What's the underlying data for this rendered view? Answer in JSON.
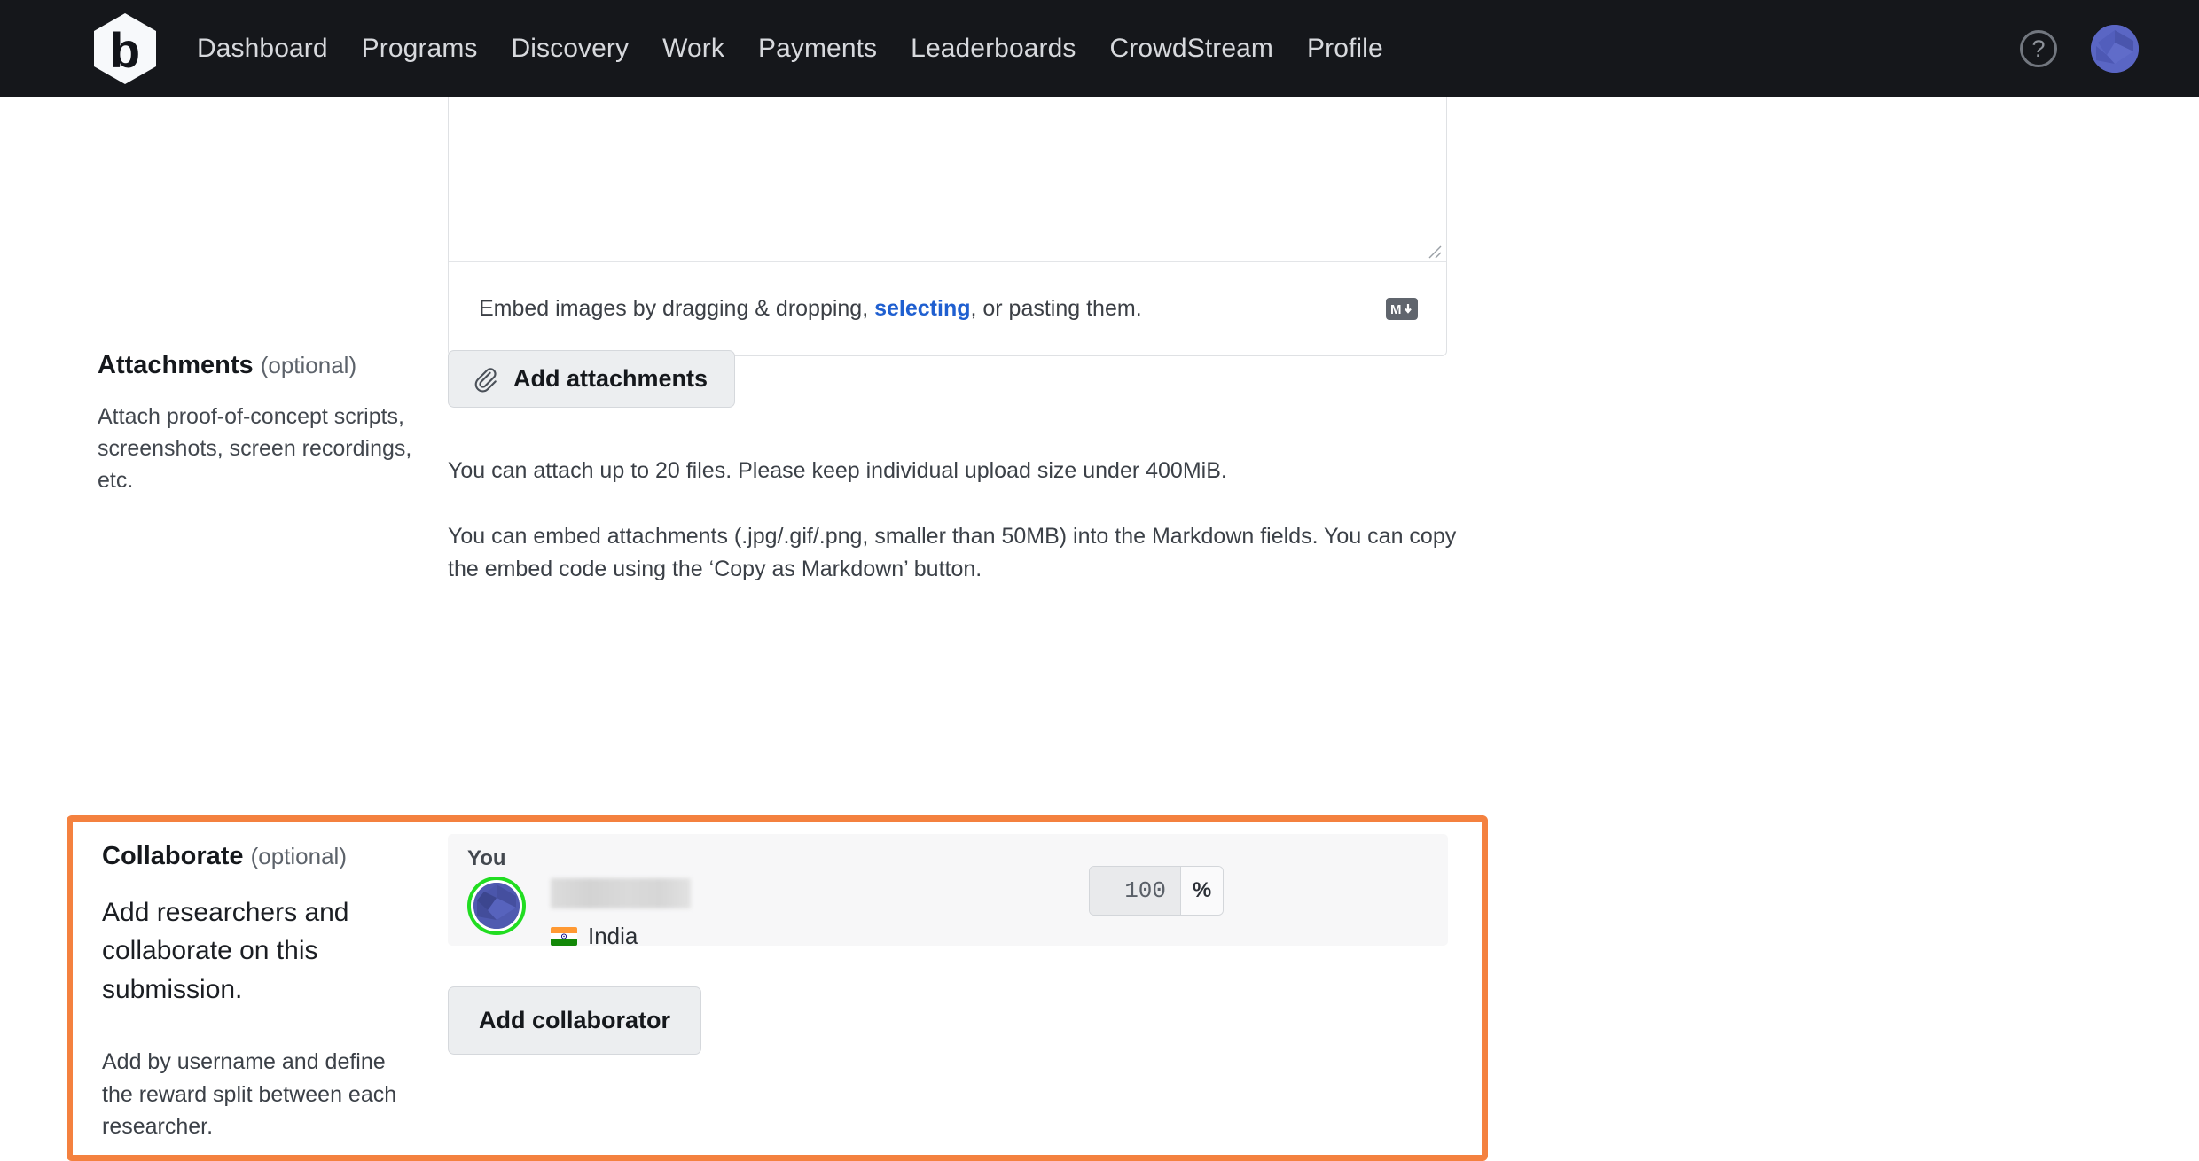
{
  "topnav": {
    "logo_icon": "bugcrowd-hexagon-logo",
    "logo_letter": "b",
    "links": [
      {
        "label": "Dashboard"
      },
      {
        "label": "Programs"
      },
      {
        "label": "Discovery"
      },
      {
        "label": "Work"
      },
      {
        "label": "Payments"
      },
      {
        "label": "Leaderboards"
      },
      {
        "label": "CrowdStream"
      },
      {
        "label": "Profile"
      }
    ],
    "help_icon": "question-mark-circle-icon",
    "help_glyph": "?",
    "avatar_icon": "user-avatar-icon"
  },
  "markdown_editor": {
    "textarea_value": "",
    "textarea_placeholder": "",
    "footer_prefix": "Embed images by dragging & dropping, ",
    "footer_link": "selecting",
    "footer_suffix": ", or pasting them.",
    "markdown_icon": "markdown-logo-icon",
    "markdown_glyph": "M↓",
    "resize_handle_icon": "resize-handle-icon"
  },
  "attachments": {
    "title": "Attachments",
    "optional": "(optional)",
    "description": "Attach proof-of-concept scripts, screenshots, screen recordings, etc.",
    "button_label": "Add attachments",
    "button_icon": "paperclip-icon",
    "note_1": "You can attach up to 20 files. Please keep individual upload size under 400MiB.",
    "note_2": "You can embed attachments (.jpg/.gif/.png, smaller than 50MB) into the Markdown fields. You can copy the embed code using the ‘Copy as Markdown’ button."
  },
  "collaborate": {
    "highlight_color": "#f4813f",
    "title": "Collaborate",
    "optional": "(optional)",
    "description_primary": "Add researchers and collaborate on this submission.",
    "description_secondary": "Add by username and define the reward split between each researcher.",
    "you_label": "You",
    "username_redacted": "",
    "country": "India",
    "country_flag_icon": "india-flag-icon",
    "avatar_icon": "collaborator-avatar-icon",
    "avatar_status_color": "#21dd21",
    "split_value": "100",
    "split_unit": "%",
    "add_button_label": "Add collaborator"
  }
}
